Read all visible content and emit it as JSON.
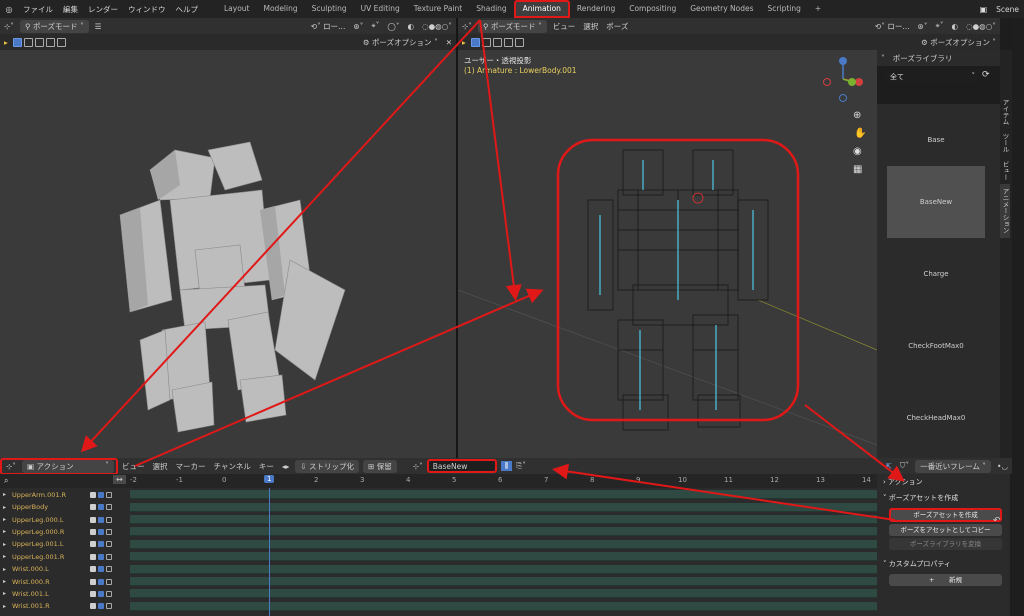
{
  "topbar": {
    "menus": [
      "ファイル",
      "編集",
      "レンダー",
      "ウィンドウ",
      "ヘルプ"
    ],
    "workspaces": [
      "Layout",
      "Modeling",
      "Sculpting",
      "UV Editing",
      "Texture Paint",
      "Shading",
      "Animation",
      "Rendering",
      "Compositing",
      "Geometry Nodes",
      "Scripting"
    ],
    "active_workspace": "Animation",
    "add_tab": "+",
    "scene": "Scene"
  },
  "left_view": {
    "mode": "ポーズモード",
    "orientation": "ロー...",
    "options": "ポーズオプション"
  },
  "right_view": {
    "mode": "ポーズモード",
    "menus": [
      "ビュー",
      "選択",
      "ポーズ"
    ],
    "orientation": "ロー...",
    "options": "ポーズオプション",
    "overlay_title": "ユーザー・透視投影",
    "overlay_object": "(1) Armature : LowerBody.001"
  },
  "pose_library": {
    "header": "ポーズライブラリ",
    "filter": "全て",
    "poses": [
      "Base",
      "BaseNew",
      "Charge",
      "CheckFootMax0",
      "CheckHeadMax0"
    ],
    "active_pose": "BaseNew"
  },
  "vtabs": [
    "アイテム",
    "ツール",
    "ビュー",
    "アニメーション"
  ],
  "dopesheet": {
    "mode": "アクション",
    "menus": [
      "ビュー",
      "選択",
      "マーカー",
      "チャンネル",
      "キー"
    ],
    "strip": "ストリップ化",
    "push": "保留",
    "action_name": "BaseNew",
    "nearest_frame": "一番近いフレーム",
    "current_frame": "1",
    "ticks": [
      "-2",
      "-1",
      "0",
      "1",
      "2",
      "3",
      "4",
      "5",
      "6",
      "7",
      "8",
      "9",
      "10",
      "11",
      "12",
      "13",
      "14"
    ],
    "channels": [
      "UpperArm.001.R",
      "UpperBody",
      "UpperLeg.000.L",
      "UpperLeg.000.R",
      "UpperLeg.001.L",
      "UpperLeg.001.R",
      "Wrist.000.L",
      "Wrist.000.R",
      "Wrist.001.L",
      "Wrist.001.R"
    ]
  },
  "ds_sidebar": {
    "action_panel": "アクション",
    "create_panel": "ポーズアセットを作成",
    "create_button": "ポーズアセットを作成",
    "copy_button": "ポーズをアセットとしてコピー",
    "paste_button": "ポーズライブラリを変換",
    "custom_props": "カスタムプロパティ",
    "new_button": "新規"
  },
  "colors": {
    "highlight": "#e01818",
    "accent": "#4a7ac7",
    "track": "#2f4a42"
  }
}
